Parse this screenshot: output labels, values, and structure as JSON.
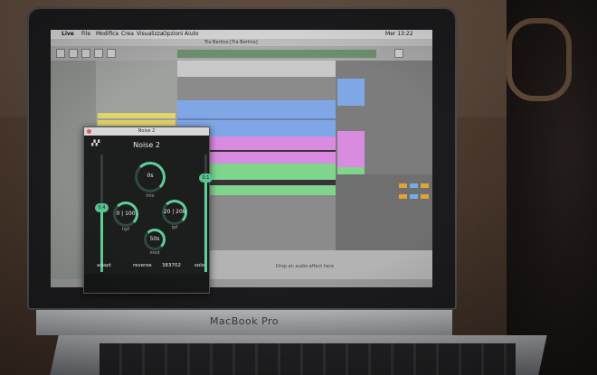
{
  "menubar": {
    "items": [
      "Live",
      "File",
      "Modifica",
      "Crea",
      "Visualizza",
      "Opzioni",
      "Aiuto"
    ],
    "clock": "Mer 13:22"
  },
  "window": {
    "title": "Tra Berlino [Tra Berlino]"
  },
  "plugin": {
    "window_title": "Noise 2",
    "name": "Noise 2",
    "knobs": [
      {
        "value": "0s",
        "label": "mix"
      },
      {
        "value": "0 | 100",
        "label": "hpf"
      },
      {
        "value": "20 | 20k",
        "label": "lpf"
      },
      {
        "value": "50s",
        "label": "mod"
      }
    ],
    "sliders": [
      {
        "value": "0.4",
        "level": 0.55
      },
      {
        "value": "0.1",
        "level": 0.8
      }
    ],
    "controls": {
      "adapt": "adapt",
      "reverse": "reverse",
      "seed": "383702",
      "solo": "solo"
    }
  },
  "detail": {
    "hint": "Drop an audio effect here"
  },
  "laptop": {
    "brand": "MacBook Pro"
  },
  "colors": {
    "accent": "#5fcf98",
    "track_blue": "#7fa7e6",
    "track_pink": "#d98be0",
    "track_green": "#7fd58c"
  }
}
